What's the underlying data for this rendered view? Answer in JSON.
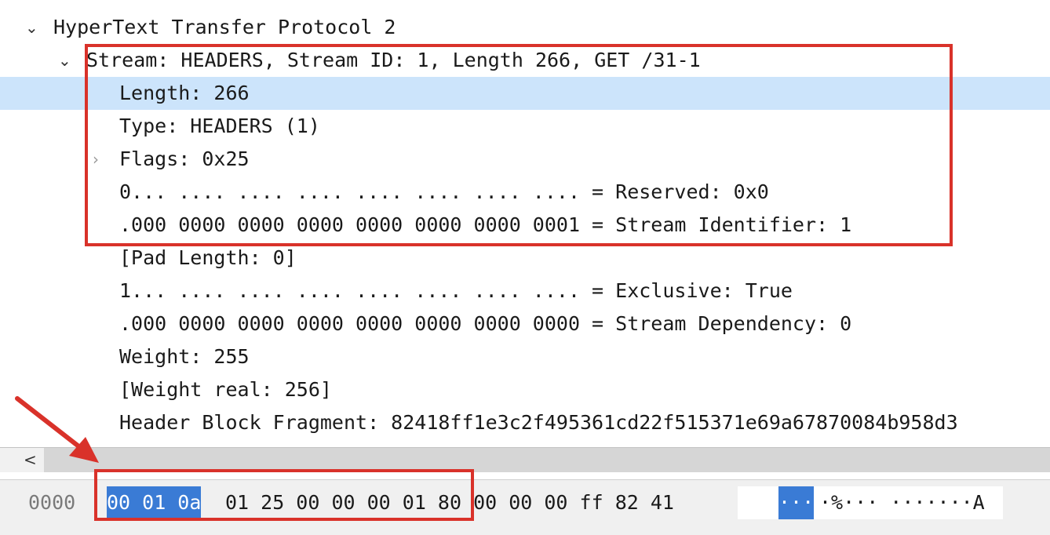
{
  "packet_tree": {
    "protocol_label": "HyperText Transfer Protocol 2",
    "stream_label": "Stream: HEADERS, Stream ID: 1, Length 266, GET /31-1",
    "fields": [
      "Length: 266",
      "Type: HEADERS (1)",
      "Flags: 0x25",
      "0... .... .... .... .... .... .... .... = Reserved: 0x0",
      ".000 0000 0000 0000 0000 0000 0000 0001 = Stream Identifier: 1",
      "[Pad Length: 0]",
      "1... .... .... .... .... .... .... .... = Exclusive: True",
      ".000 0000 0000 0000 0000 0000 0000 0000 = Stream Dependency: 0",
      "Weight: 255",
      "[Weight real: 256]",
      "Header Block Fragment: 82418ff1e3c2f495361cd22f515371e69a67870084b958d3"
    ],
    "selected_field_index": 0
  },
  "scrollbar": {
    "left_arrow": "<"
  },
  "hex_dump": {
    "offset": "0000",
    "selected_bytes": "00 01 0a",
    "rest_bytes": "01 25 00 00 00  01 80 00 00 00 ff 82 41",
    "ascii_selected": "···",
    "ascii_rest": "·%··· ·······A"
  },
  "icons": {
    "expanded": "chevron-down-icon",
    "collapsed": "chevron-right-icon",
    "annotation": "red-arrow"
  },
  "colors": {
    "selection_row": "#cce4fb",
    "selection_bytes": "#3a7bd5",
    "annotation_red": "#d9322a"
  }
}
